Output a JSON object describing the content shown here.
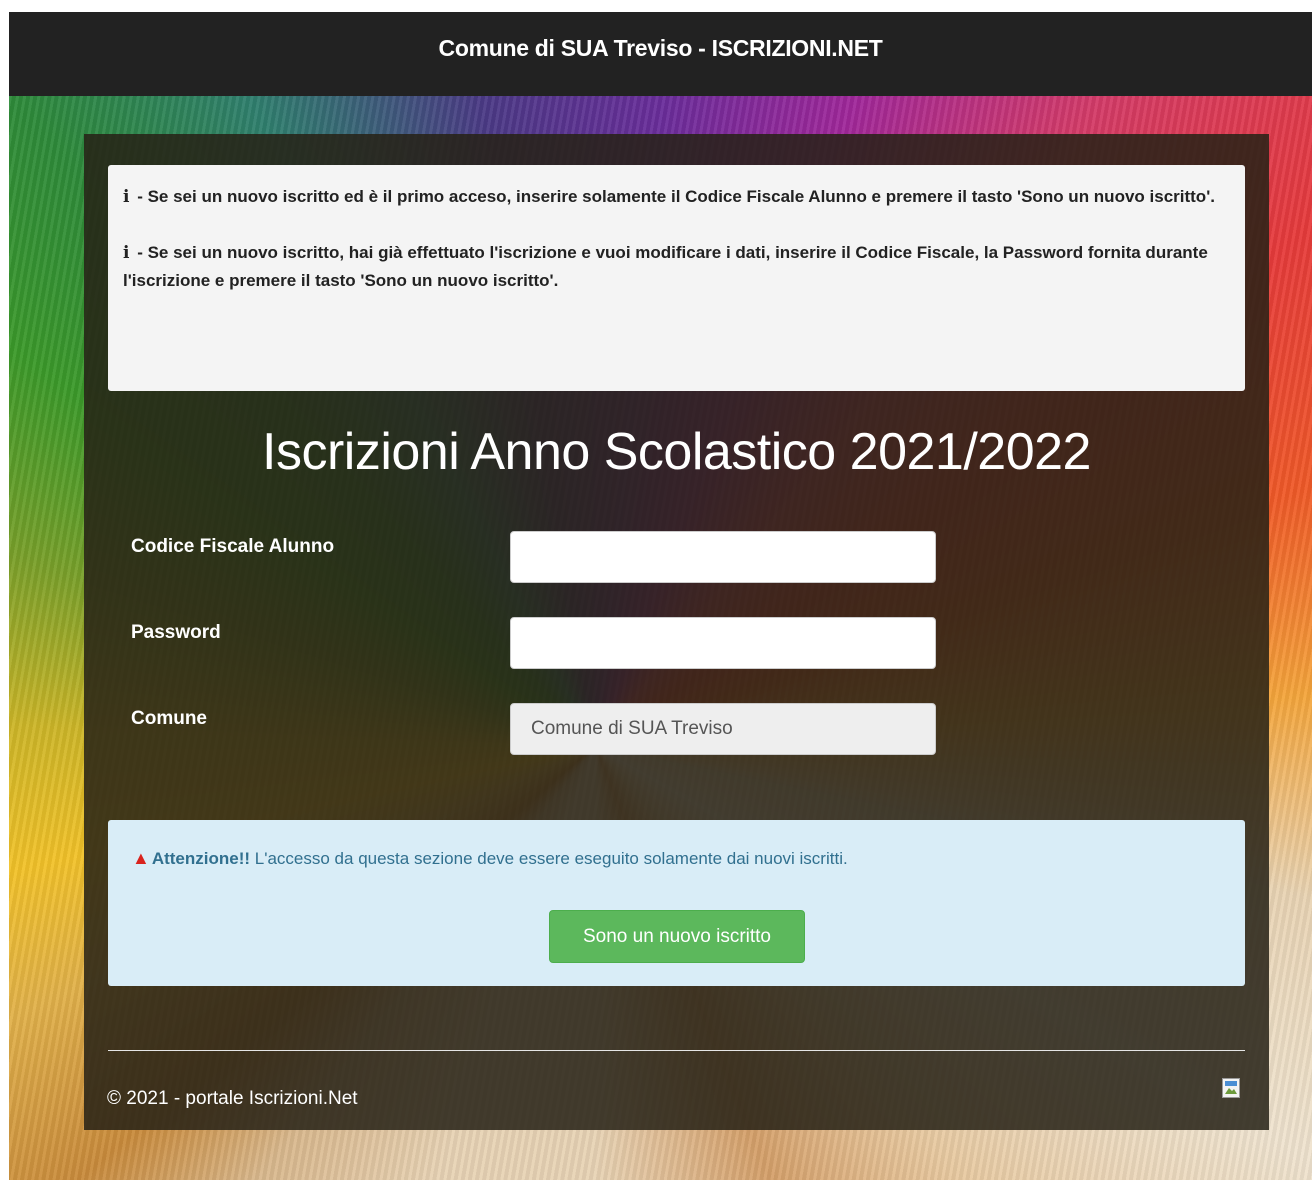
{
  "header": {
    "title": "Comune di SUA Treviso - ISCRIZIONI.NET"
  },
  "info": {
    "icon": "info-icon",
    "first": {
      "prefix": " - ",
      "text": "Se sei un nuovo iscritto ed è il primo acceso, inserire solamente il Codice Fiscale Alunno e premere il tasto 'Sono un nuovo iscritto'."
    },
    "second": {
      "prefix": " - ",
      "text": "Se sei un nuovo iscritto, hai già effettuato l'iscrizione e vuoi modificare i dati, inserire il Codice Fiscale, la Password fornita durante l'iscrizione e premere il tasto 'Sono un nuovo iscritto'."
    }
  },
  "main": {
    "title": "Iscrizioni Anno Scolastico 2021/2022"
  },
  "form": {
    "codice_fiscale": {
      "label": "Codice Fiscale Alunno",
      "value": "",
      "placeholder": ""
    },
    "password": {
      "label": "Password",
      "value": "",
      "placeholder": ""
    },
    "comune": {
      "label": "Comune",
      "value": "Comune di SUA Treviso"
    }
  },
  "alert": {
    "icon": "warning-icon",
    "strong": "Attenzione!!",
    "text": " L'accesso da questa sezione deve essere eseguito solamente dai nuovi iscritti.",
    "button_label": "Sono un nuovo iscritto",
    "colors": {
      "background": "#d9edf7",
      "text": "#31708f",
      "button": "#5cb85c",
      "warning": "#d9231d"
    }
  },
  "footer": {
    "text": "© 2021 - portale Iscrizioni.Net",
    "image_icon": "broken-image-icon"
  }
}
